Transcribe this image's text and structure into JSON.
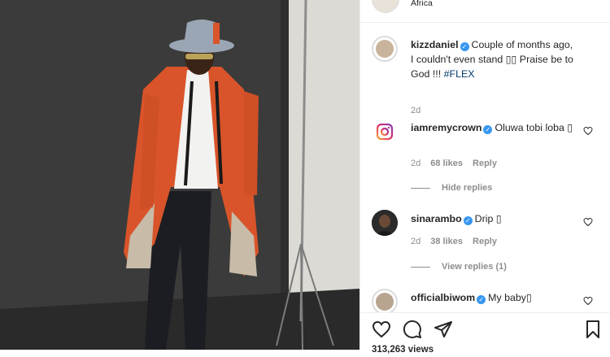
{
  "header": {
    "location": "Africa"
  },
  "caption": {
    "username": "kizzdaniel",
    "text": "Couple of months ago, I couldn't even stand ",
    "emoji": "▯▯",
    "text2": " Praise be to God !!! ",
    "hashtag": "#FLEX",
    "time": "2d"
  },
  "comments": [
    {
      "username": "iamremycrown",
      "text": "Oluwa tobi loba ▯",
      "time": "2d",
      "likes": "68 likes",
      "reply": "Reply",
      "replies_label": "Hide replies"
    },
    {
      "username": "sinarambo",
      "text": "Drip ▯",
      "time": "2d",
      "likes": "38 likes",
      "reply": "Reply",
      "replies_label": "View replies (1)"
    },
    {
      "username": "officialbiwom",
      "text": "My baby▯"
    }
  ],
  "footer": {
    "views": "313,263 views"
  },
  "icons": {
    "like": "heart-icon",
    "comment": "comment-icon",
    "share": "share-icon",
    "save": "bookmark-icon",
    "verified": "verified-badge-icon",
    "instagram": "instagram-logo-icon"
  },
  "colors": {
    "verified": "#3897f0",
    "hashtag": "#00376b",
    "muted": "#8e8e8e",
    "jacket": "#d9542a"
  }
}
